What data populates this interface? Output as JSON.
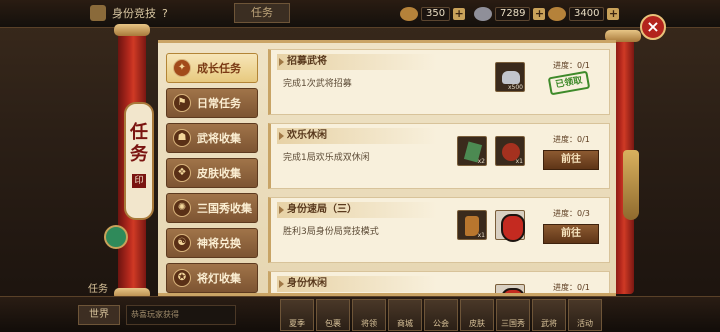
{
  "topbar": {
    "title": "身份竞技",
    "help": "?",
    "task_tab": "任务",
    "resources": [
      {
        "value": "350",
        "icon": "ingot-icon"
      },
      {
        "value": "7289",
        "icon": "silver-icon"
      },
      {
        "value": "3400",
        "icon": "gold-icon"
      }
    ],
    "plus": "+"
  },
  "close": "×",
  "banner": {
    "char1": "任",
    "char2": "务",
    "mark": "印"
  },
  "tabs": [
    {
      "label": "成长任务",
      "icon": "growth-icon"
    },
    {
      "label": "日常任务",
      "icon": "flag-icon"
    },
    {
      "label": "武将收集",
      "icon": "helmet-icon"
    },
    {
      "label": "皮肤收集",
      "icon": "armor-icon"
    },
    {
      "label": "三国秀收集",
      "icon": "flame-icon"
    },
    {
      "label": "神将兑换",
      "icon": "hero-icon"
    },
    {
      "label": "将灯收集",
      "icon": "lantern-icon"
    }
  ],
  "tab_icon_glyphs": [
    "✦",
    "⚑",
    "☗",
    "❖",
    "✺",
    "☯",
    "✪"
  ],
  "cards": [
    {
      "name": "招募武将",
      "desc": "完成1次武将招募",
      "progress": "进度：0/1",
      "items": [
        {
          "kind": "silver",
          "qty": "x500"
        }
      ],
      "claimed": "已领取"
    },
    {
      "name": "欢乐休闲",
      "desc": "完成1局欢乐成双休闲",
      "progress": "进度：0/1",
      "items": [
        {
          "kind": "green",
          "qty": "x2"
        },
        {
          "kind": "red",
          "qty": "x1"
        }
      ],
      "button": "前往"
    },
    {
      "name": "身份速局（三）",
      "desc": "胜利3局身份局竞技模式",
      "progress": "进度：0/3",
      "items": [
        {
          "kind": "boot",
          "qty": "x1"
        },
        {
          "kind": "mask",
          "qty": "x1"
        }
      ],
      "button": "前往"
    },
    {
      "name": "身份休闲",
      "desc": "",
      "progress": "进度：0/1",
      "items": [
        {
          "kind": "mask",
          "qty": ""
        }
      ],
      "button": ""
    }
  ],
  "bottom": {
    "task_label": "任务",
    "world": "世界",
    "chat": "恭喜玩家获得",
    "nav": [
      "夏季",
      "包裹",
      "将领",
      "商城",
      "公会",
      "皮肤",
      "三国秀",
      "武将",
      "活动"
    ]
  }
}
